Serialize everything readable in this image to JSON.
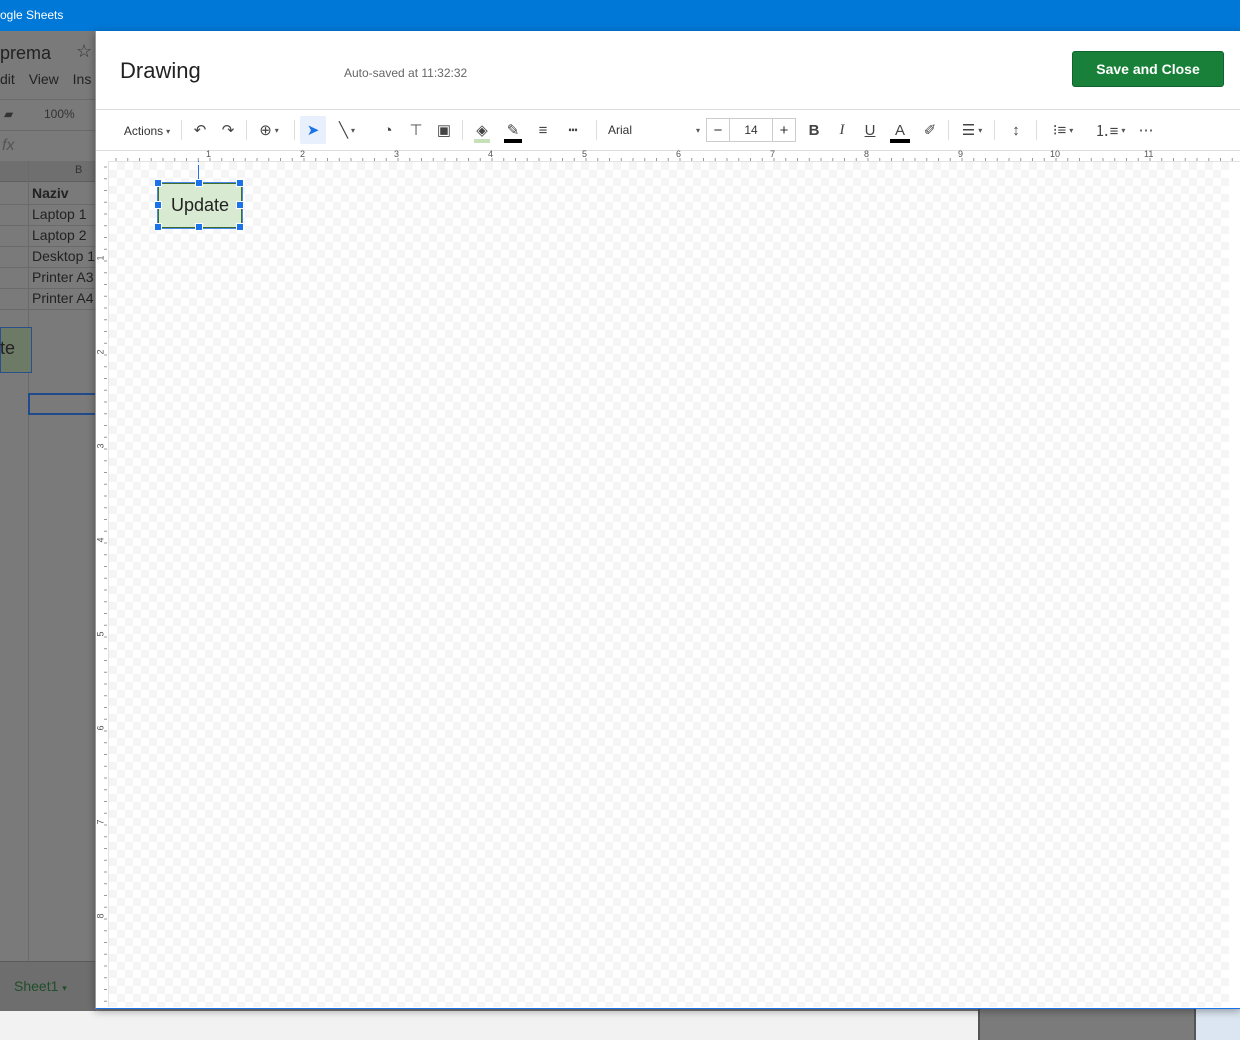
{
  "window": {
    "title": "ogle Sheets"
  },
  "spreadsheet": {
    "doc_title": "prema",
    "menus": [
      "dit",
      "View",
      "Ins"
    ],
    "zoom": "100%",
    "fx": "fx",
    "column_b": "B",
    "cells": [
      "Naziv",
      "Laptop 1",
      "Laptop 2",
      "Desktop 1",
      "Printer A3",
      "Printer A4"
    ],
    "button_fragment": "te",
    "sheet_tab": "Sheet1"
  },
  "dialog": {
    "title": "Drawing",
    "autosave": "Auto-saved at 11:32:32",
    "save_close": "Save and Close",
    "toolbar": {
      "actions": "Actions",
      "font": "Arial",
      "font_size": "14",
      "minus": "−",
      "plus": "+",
      "bold": "B",
      "italic": "I",
      "underline": "U",
      "text_color": "A",
      "more": "⋯"
    },
    "ruler_h": [
      "1",
      "2",
      "3",
      "4",
      "5",
      "6",
      "7",
      "8",
      "9",
      "10",
      "11"
    ],
    "ruler_v": [
      "1",
      "2",
      "3",
      "4",
      "5",
      "6",
      "7",
      "8"
    ],
    "shape_text": "Update"
  },
  "colors": {
    "accent": "#1a73e8",
    "save_button": "#188038",
    "shape_fill": "#d9ead3"
  }
}
